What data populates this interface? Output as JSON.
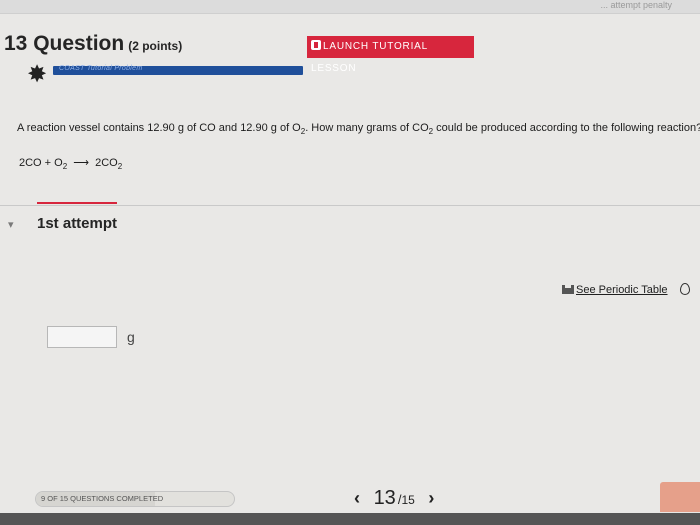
{
  "top_strip": {
    "text": "... attempt penalty"
  },
  "header": {
    "question_number": "13 Question",
    "points": "(2 points)",
    "launch_button_label": "LAUNCH TUTORIAL LESSON",
    "progress_label": "COAST Tutorial Problem"
  },
  "question": {
    "text_before": "A reaction vessel contains 12.90 g of CO and 12.90 g of O",
    "o2_sub": "2",
    "text_middle": ". How many grams of CO",
    "co2_sub": "2",
    "text_after": " could be produced according to the following reaction?"
  },
  "equation": {
    "lhs_co": "2CO + O",
    "lhs_sub": "2",
    "rhs_co2": "2CO",
    "rhs_sub": "2"
  },
  "attempt": {
    "label": "1st attempt"
  },
  "periodic_table": {
    "link_label": "See Periodic Table"
  },
  "answer": {
    "value": "",
    "unit": "g"
  },
  "footer": {
    "completed_label": "9 OF 15 QUESTIONS COMPLETED",
    "current": "13",
    "total": "15"
  },
  "colors": {
    "accent_red": "#d7263d",
    "progress_blue": "#1f4f9a"
  }
}
